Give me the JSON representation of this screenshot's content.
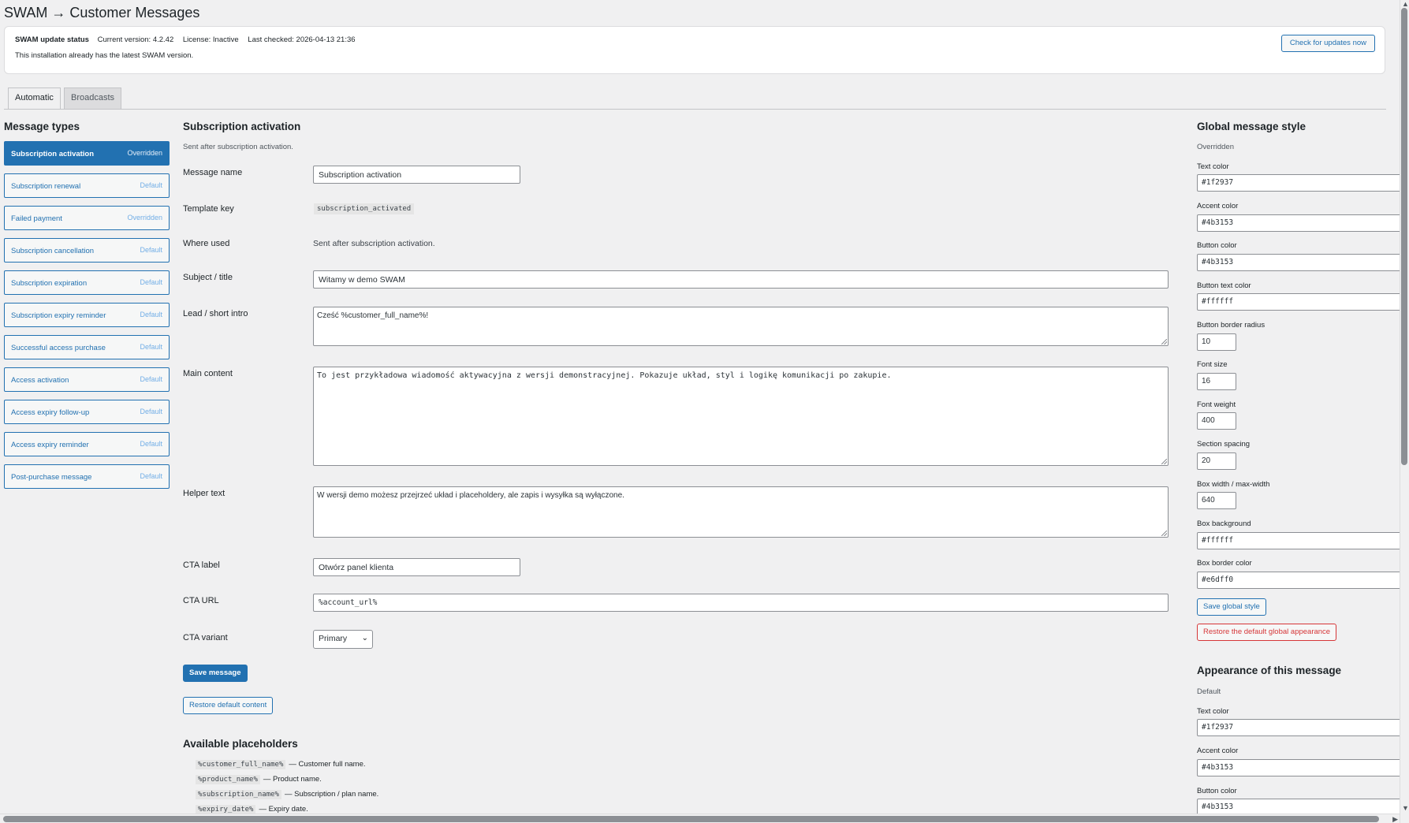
{
  "page": {
    "title": "SWAM → Customer Messages"
  },
  "update": {
    "title": "SWAM update status",
    "version": "Current version: 4.2.42",
    "license": "License: Inactive",
    "checked": "Last checked: 2026-04-13 21:36",
    "note": "This installation already has the latest SWAM version.",
    "check_button": "Check for updates now"
  },
  "tabs": [
    {
      "label": "Automatic"
    },
    {
      "label": "Broadcasts"
    }
  ],
  "message_types": {
    "heading": "Message types",
    "items": [
      {
        "label": "Subscription activation",
        "status": "Overridden"
      },
      {
        "label": "Subscription renewal",
        "status": "Default"
      },
      {
        "label": "Failed payment",
        "status": "Overridden"
      },
      {
        "label": "Subscription cancellation",
        "status": "Default"
      },
      {
        "label": "Subscription expiration",
        "status": "Default"
      },
      {
        "label": "Subscription expiry reminder",
        "status": "Default"
      },
      {
        "label": "Successful access purchase",
        "status": "Default"
      },
      {
        "label": "Access activation",
        "status": "Default"
      },
      {
        "label": "Access expiry follow-up",
        "status": "Default"
      },
      {
        "label": "Access expiry reminder",
        "status": "Default"
      },
      {
        "label": "Post-purchase message",
        "status": "Default"
      }
    ]
  },
  "editor": {
    "heading": "Subscription activation",
    "description": "Sent after subscription activation.",
    "labels": {
      "message_name": "Message name",
      "template_key": "Template key",
      "where_used": "Where used",
      "subject": "Subject / title",
      "lead": "Lead / short intro",
      "main_content": "Main content",
      "helper_text": "Helper text",
      "cta_label": "CTA label",
      "cta_url": "CTA URL",
      "cta_variant": "CTA variant"
    },
    "values": {
      "message_name": "Subscription activation",
      "template_key": "subscription_activated",
      "where_used": "Sent after subscription activation.",
      "subject": "Witamy w demo SWAM",
      "lead": "Cześć %customer_full_name%!",
      "main_content": "To jest przykładowa wiadomość aktywacyjna z wersji demonstracyjnej. Pokazuje układ, styl i logikę komunikacji po zakupie.",
      "helper_text": "W wersji demo możesz przejrzeć układ i placeholdery, ale zapis i wysyłka są wyłączone.",
      "cta_label": "Otwórz panel klienta",
      "cta_url": "%account_url%",
      "cta_variant": "Primary"
    },
    "save_button": "Save message",
    "restore_button": "Restore default content"
  },
  "placeholders": {
    "heading": "Available placeholders",
    "items": [
      {
        "code": "%customer_full_name%",
        "desc": "— Customer full name."
      },
      {
        "code": "%product_name%",
        "desc": "— Product name."
      },
      {
        "code": "%subscription_name%",
        "desc": "— Subscription / plan name."
      },
      {
        "code": "%expiry_date%",
        "desc": "— Expiry date."
      }
    ]
  },
  "global_style": {
    "heading": "Global message style",
    "status": "Overridden",
    "fields": [
      {
        "label": "Text color",
        "value": "#1f2937"
      },
      {
        "label": "Accent color",
        "value": "#4b3153"
      },
      {
        "label": "Button color",
        "value": "#4b3153"
      },
      {
        "label": "Button text color",
        "value": "#ffffff"
      },
      {
        "label": "Button border radius",
        "value": "10"
      },
      {
        "label": "Font size",
        "value": "16"
      },
      {
        "label": "Font weight",
        "value": "400"
      },
      {
        "label": "Section spacing",
        "value": "20"
      },
      {
        "label": "Box width / max-width",
        "value": "640"
      },
      {
        "label": "Box background",
        "value": "#ffffff"
      },
      {
        "label": "Box border color",
        "value": "#e6dff0"
      }
    ],
    "save_button": "Save global style",
    "restore_button": "Restore the default global appearance"
  },
  "message_style": {
    "heading": "Appearance of this message",
    "status": "Default",
    "fields": [
      {
        "label": "Text color",
        "value": "#1f2937"
      },
      {
        "label": "Accent color",
        "value": "#4b3153"
      },
      {
        "label": "Button color",
        "value": "#4b3153"
      }
    ]
  },
  "colors": {
    "accent": "#2271b1",
    "danger": "#d63638",
    "background": "#f0f0f1"
  }
}
